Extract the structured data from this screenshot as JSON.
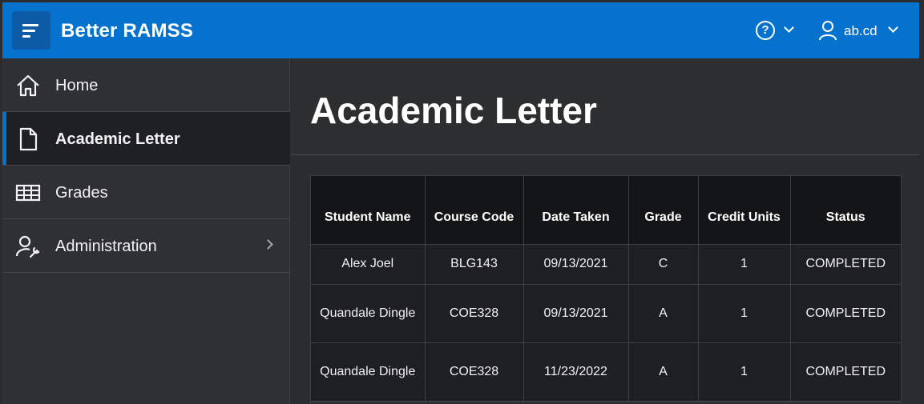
{
  "header": {
    "app_title": "Better RAMSS",
    "help_label": "?",
    "user_name": "ab.cd",
    "accent_color": "#0572ce"
  },
  "sidebar": {
    "items": [
      {
        "label": "Home",
        "icon": "home-icon",
        "active": false
      },
      {
        "label": "Academic Letter",
        "icon": "document-icon",
        "active": true
      },
      {
        "label": "Grades",
        "icon": "table-icon",
        "active": false
      },
      {
        "label": "Administration",
        "icon": "user-wrench-icon",
        "active": false,
        "has_submenu": true
      }
    ]
  },
  "main": {
    "page_title": "Academic Letter",
    "table": {
      "columns": [
        "Student Name",
        "Course Code",
        "Date Taken",
        "Grade",
        "Credit Units",
        "Status"
      ],
      "rows": [
        [
          "Alex Joel",
          "BLG143",
          "09/13/2021",
          "C",
          "1",
          "COMPLETED"
        ],
        [
          "Quandale Dingle",
          "COE328",
          "09/13/2021",
          "A",
          "1",
          "COMPLETED"
        ],
        [
          "Quandale Dingle",
          "COE328",
          "11/23/2022",
          "A",
          "1",
          "COMPLETED"
        ]
      ]
    }
  }
}
